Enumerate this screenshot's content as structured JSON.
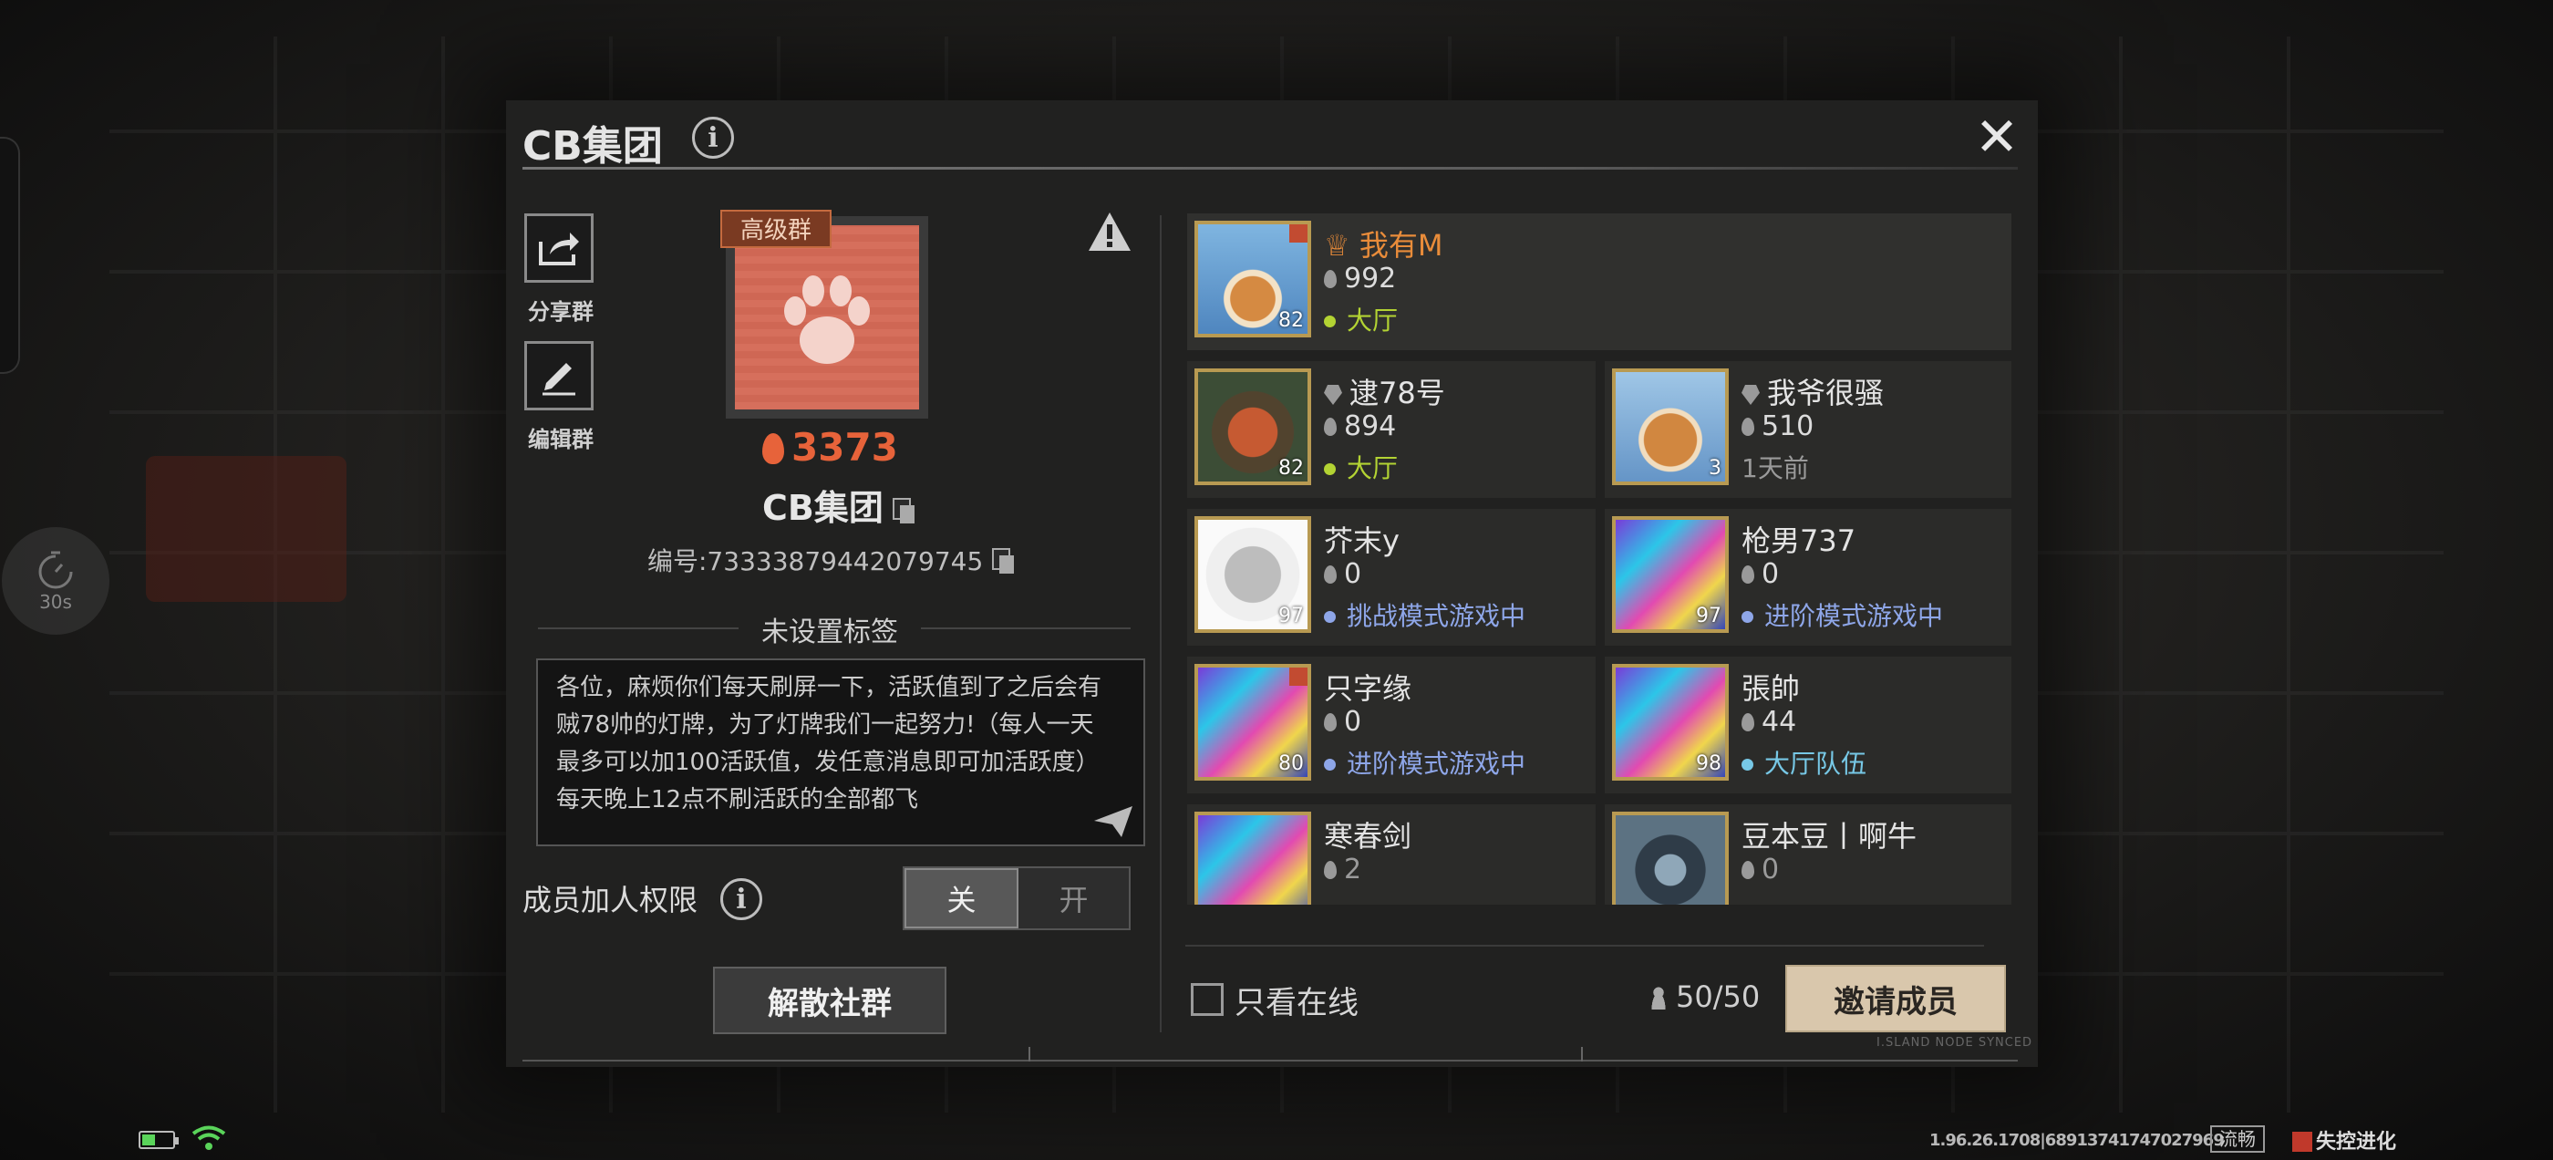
{
  "dialog": {
    "title": "CB集团",
    "close": "✕"
  },
  "sidebar": {
    "share_label": "分享群",
    "edit_label": "编辑群"
  },
  "group": {
    "badge": "高级群",
    "score": "3373",
    "name": "CB集团",
    "id_text": "编号:7333387944207974​5",
    "tag_header": "未设置标签",
    "description": [
      "各位，麻烦你们每天刷屏一下，活跃值到了之后会有",
      "贼78帅的灯牌，为了灯牌我们一起努力!（每人一天",
      "最多可以加100活跃值，发任意消息即可加活跃度）",
      "每天晚上12点不刷活跃的全部都飞"
    ]
  },
  "permission": {
    "label": "成员加人权限",
    "off": "关",
    "on": "开"
  },
  "disband": "解散社群",
  "members": [
    {
      "name": "我有M",
      "activity": "992",
      "status": "大厅",
      "level": "82",
      "owner": true
    },
    {
      "name": "逮78号",
      "activity": "894",
      "status": "大厅",
      "level": "82"
    },
    {
      "name": "我爷很骚",
      "activity": "510",
      "status": "1天前",
      "level": "3"
    },
    {
      "name": "芥末y",
      "activity": "0",
      "status": "挑战模式游戏中",
      "level": "97"
    },
    {
      "name": "枪男737",
      "activity": "0",
      "status": "进阶模式游戏中",
      "level": "97"
    },
    {
      "name": "只字缘",
      "activity": "0",
      "status": "进阶模式游戏中",
      "level": "80"
    },
    {
      "name": "張帥",
      "activity": "44",
      "status": "大厅队伍",
      "level": "98"
    },
    {
      "name": "寒春剑",
      "activity": "2"
    },
    {
      "name": "豆本豆丨啊牛",
      "activity": "0"
    }
  ],
  "footer": {
    "online_only": "只看在线",
    "member_count": "50/50",
    "invite": "邀请成员",
    "synced": "I.SLAND NODE SYNCED"
  },
  "hud": {
    "timer": "30s",
    "version": "1.96.26.1708|68913741747027969",
    "fluent": "流畅",
    "logo": "失控进化"
  },
  "colors": {
    "accent_orange": "#e7633a",
    "lobby_green": "#b3d333",
    "ingame_blue": "#8ea6e8",
    "team_cyan": "#77c8e6",
    "offline_gray": "#9a9a9a"
  }
}
